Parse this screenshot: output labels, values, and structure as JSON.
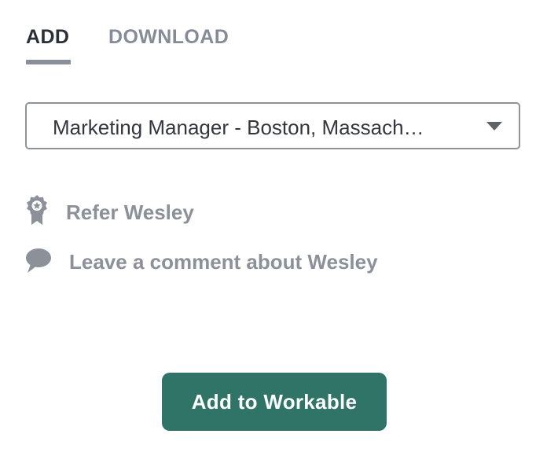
{
  "tabs": [
    {
      "label": "ADD",
      "active": true
    },
    {
      "label": "DOWNLOAD",
      "active": false
    }
  ],
  "job_select": {
    "selected": "Marketing Manager - Boston, Massach…",
    "icon": "chevron-down-icon"
  },
  "actions": {
    "refer": {
      "label": "Refer Wesley",
      "icon": "award-badge-icon"
    },
    "comment": {
      "label": "Leave a comment about Wesley",
      "icon": "speech-bubble-icon"
    }
  },
  "primary_button": {
    "label": "Add to Workable",
    "color": "#2f7466"
  },
  "colors": {
    "active_tab": "#2b2f36",
    "inactive_tab": "#858c96",
    "muted_text": "#8c9199",
    "accent": "#2f7466"
  }
}
